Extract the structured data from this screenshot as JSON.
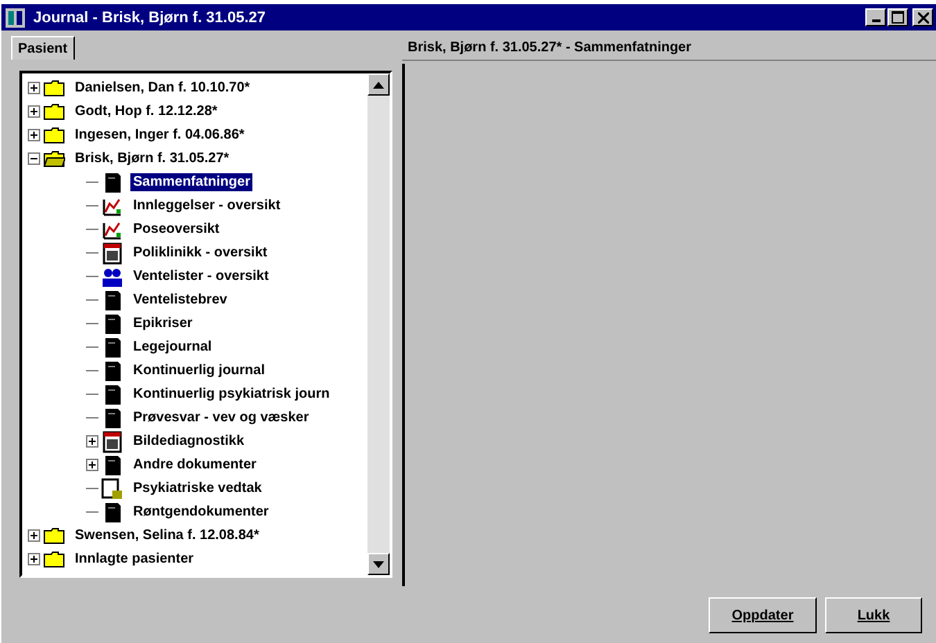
{
  "window": {
    "title": "Journal - Brisk, Bjørn f. 31.05.27"
  },
  "tabs": [
    {
      "label": "Pasient",
      "selected": true
    }
  ],
  "tree": [
    {
      "label": "Danielsen, Dan f. 10.10.70*",
      "kind": "folder",
      "expanded": false,
      "selected": false
    },
    {
      "label": "Godt, Hop f. 12.12.28*",
      "kind": "folder",
      "expanded": false,
      "selected": false
    },
    {
      "label": "Ingesen, Inger f. 04.06.86*",
      "kind": "folder",
      "expanded": false,
      "selected": false
    },
    {
      "label": "Brisk, Bjørn f. 31.05.27*",
      "kind": "folder",
      "expanded": true,
      "selected": false,
      "children": [
        {
          "label": "Sammenfatninger",
          "kind": "book",
          "selected": true
        },
        {
          "label": "Innleggelser - oversikt",
          "kind": "chart",
          "selected": false
        },
        {
          "label": "Poseoversikt",
          "kind": "chart",
          "selected": false
        },
        {
          "label": "Poliklinikk - oversikt",
          "kind": "calendar",
          "selected": false
        },
        {
          "label": "Ventelister - oversikt",
          "kind": "people",
          "selected": false
        },
        {
          "label": "Ventelistebrev",
          "kind": "book",
          "selected": false
        },
        {
          "label": "Epikriser",
          "kind": "book",
          "selected": false
        },
        {
          "label": "Legejournal",
          "kind": "book",
          "selected": false
        },
        {
          "label": "Kontinuerlig journal",
          "kind": "book",
          "selected": false
        },
        {
          "label": "Kontinuerlig psykiatrisk journ",
          "kind": "book",
          "selected": false
        },
        {
          "label": "Prøvesvar - vev og væsker",
          "kind": "book",
          "selected": false
        },
        {
          "label": "Bildediagnostikk",
          "kind": "calendar",
          "expanded": false,
          "selected": false
        },
        {
          "label": "Andre dokumenter",
          "kind": "book",
          "expanded": false,
          "selected": false
        },
        {
          "label": "Psykiatriske vedtak",
          "kind": "note",
          "selected": false
        },
        {
          "label": "Røntgendokumenter",
          "kind": "book",
          "selected": false
        }
      ]
    },
    {
      "label": "Swensen, Selina f. 12.08.84*",
      "kind": "folder",
      "expanded": false,
      "selected": false
    },
    {
      "label": "Innlagte pasienter",
      "kind": "folder",
      "expanded": false,
      "selected": false
    }
  ],
  "detail": {
    "header": "Brisk, Bjørn f. 31.05.27* - Sammenfatninger"
  },
  "buttons": [
    "Oppdater",
    "Lukk"
  ]
}
